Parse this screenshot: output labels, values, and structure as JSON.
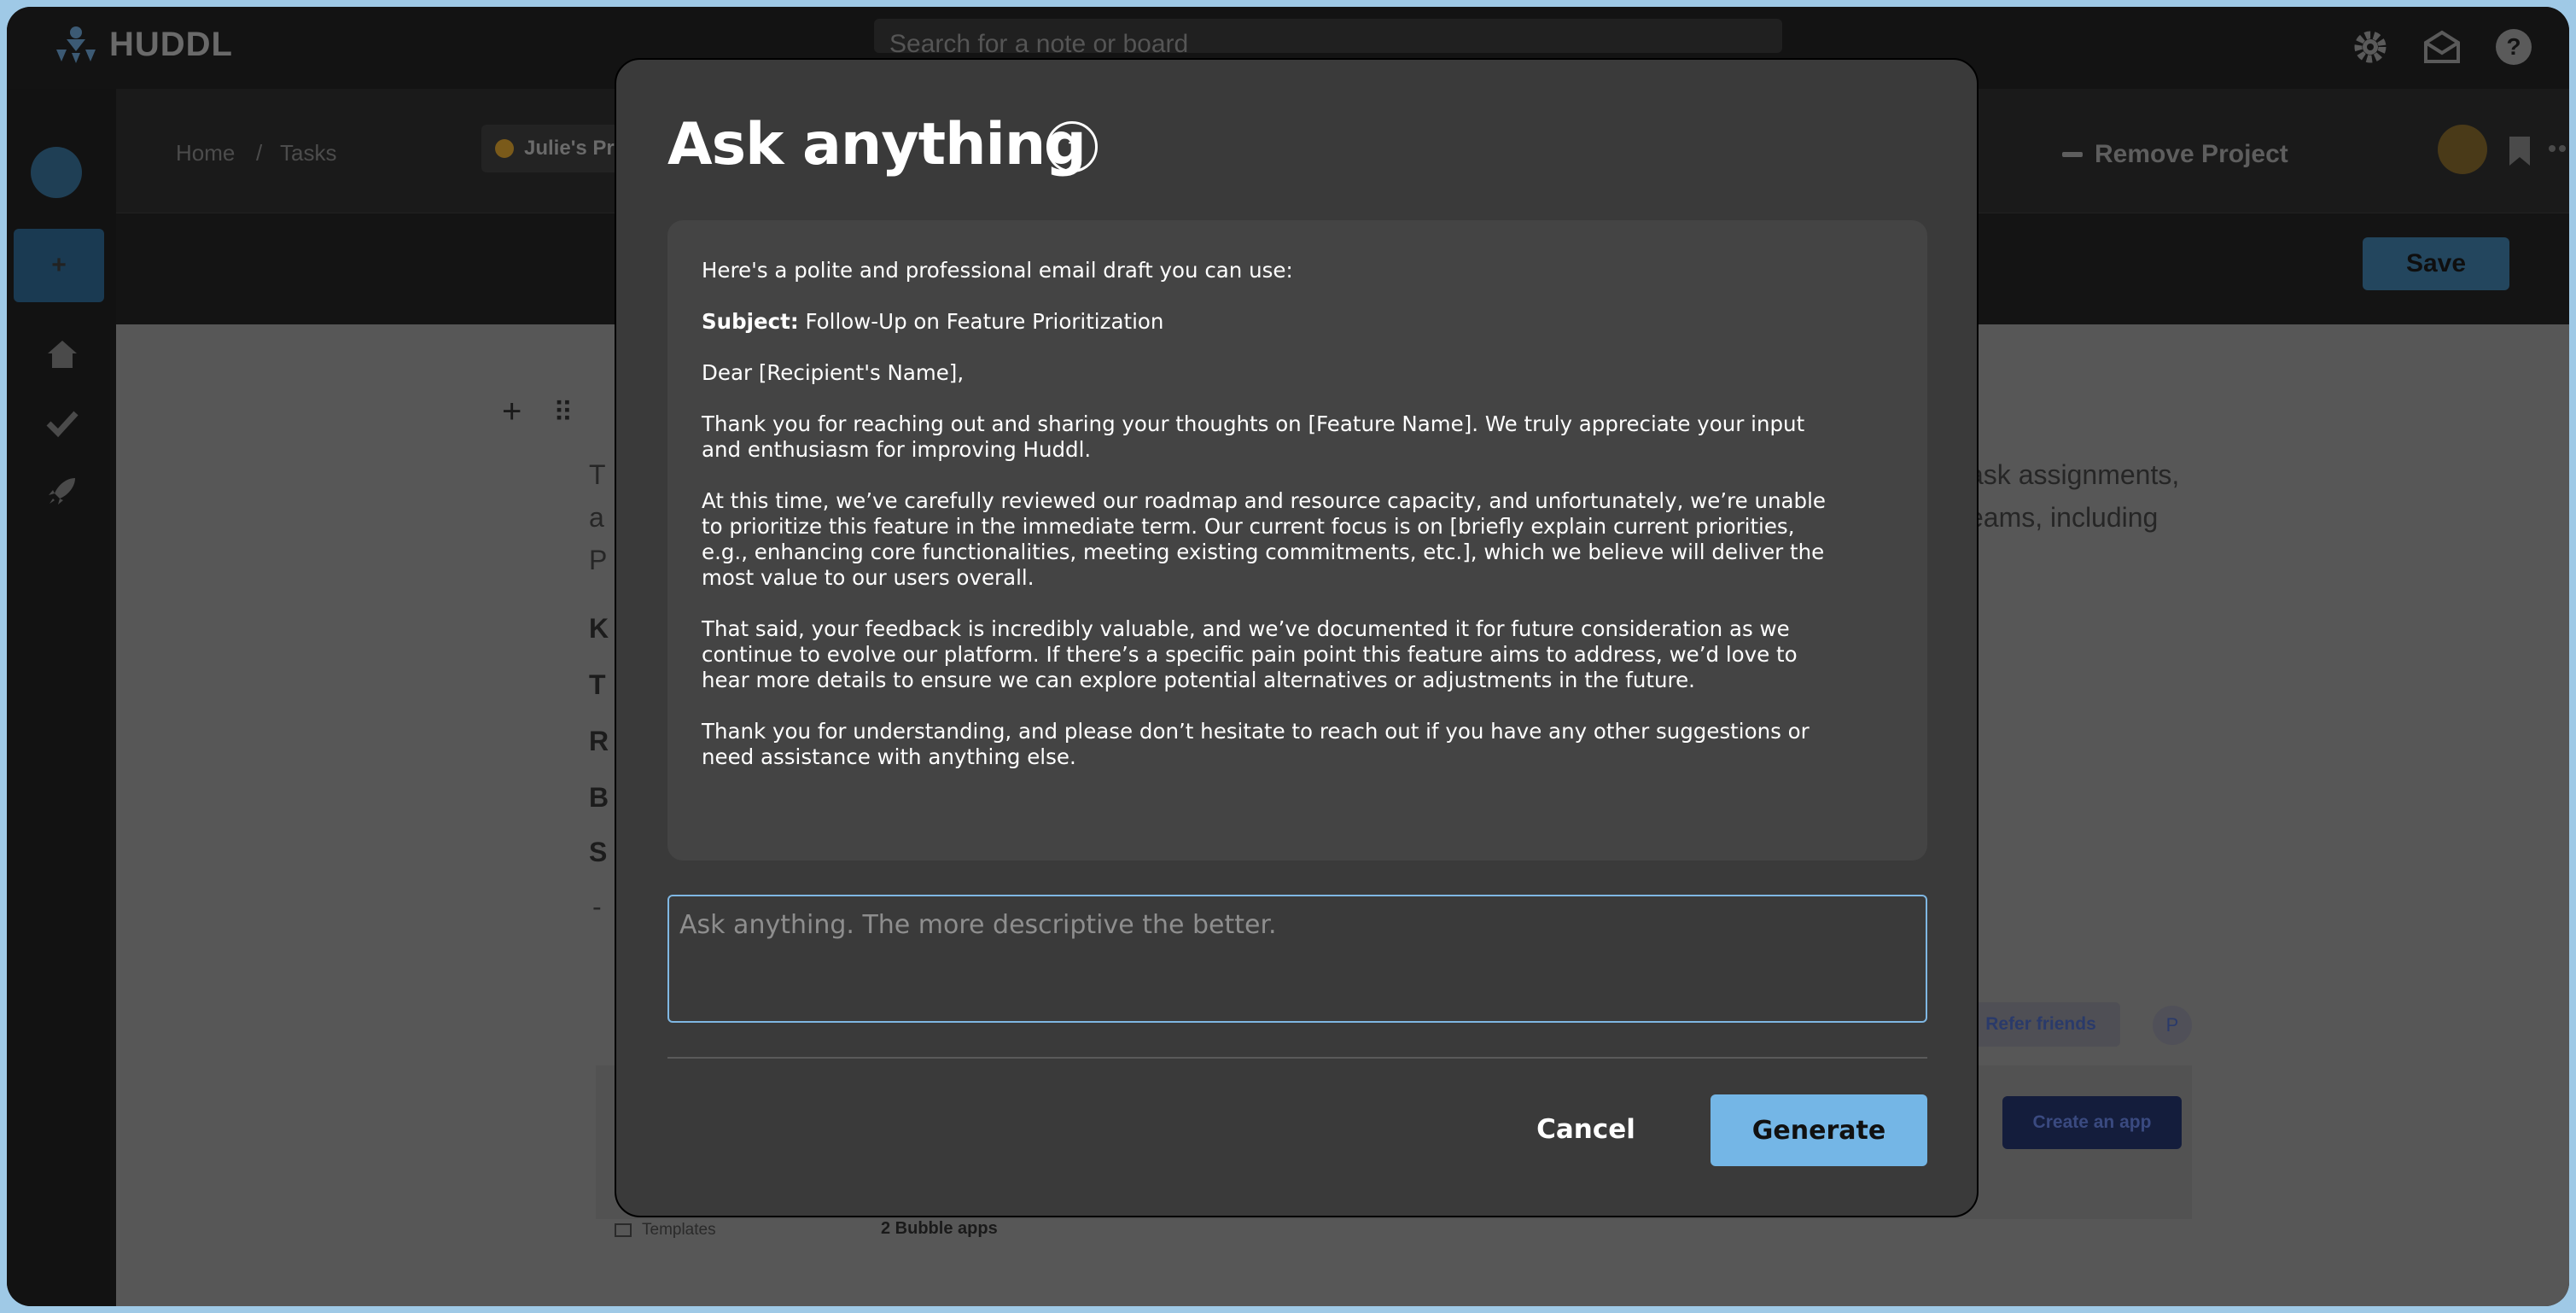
{
  "app": {
    "logo_text": "HUDDL"
  },
  "topbar": {
    "search_placeholder": "Search for a note or board"
  },
  "breadcrumb": {
    "home": "Home",
    "sep": "/",
    "tasks": "Tasks",
    "project": "Julie's Project"
  },
  "header": {
    "remove_project": "Remove Project",
    "save": "Save"
  },
  "background": {
    "line1_end": "ask assignments,",
    "line2_end": "eams, including",
    "letters": [
      "T",
      "a",
      "P",
      "K",
      "T",
      "R",
      "B",
      "S",
      "-"
    ],
    "refer_friends": "Refer friends",
    "profile_initial": "P",
    "create_app": "Create an app",
    "templates": "Templates",
    "bubble_apps": "2 Bubble apps"
  },
  "modal": {
    "title": "Ask anything",
    "info_glyph": "i",
    "response": {
      "intro": "Here's a polite and professional email draft you can use:",
      "subject_label": "Subject:",
      "subject_text": " Follow-Up on Feature Prioritization",
      "greeting": "Dear [Recipient's Name],",
      "p1": "Thank you for reaching out and sharing your thoughts on [Feature Name]. We truly appreciate your input and enthusiasm for improving Huddl.",
      "p2": "At this time, we’ve carefully reviewed our roadmap and resource capacity, and unfortunately, we’re unable to prioritize this feature in the immediate term. Our current focus is on [briefly explain current priorities, e.g., enhancing core functionalities, meeting existing commitments, etc.], which we believe will deliver the most value to our users overall.",
      "p3": "That said, your feedback is incredibly valuable, and we’ve documented it for future consideration as we continue to evolve our platform. If there’s a specific pain point this feature aims to address, we’d love to hear more details to ensure we can explore potential alternatives or adjustments in the future.",
      "p4": "Thank you for understanding, and please don’t hesitate to reach out if you have any other suggestions or need assistance with anything else."
    },
    "input_placeholder": "Ask anything. The more descriptive the better.",
    "cancel_label": "Cancel",
    "generate_label": "Generate"
  },
  "colors": {
    "accent": "#74b6e6",
    "modal_bg": "#3a3a3a",
    "response_bg": "#444444",
    "frame_border": "#9fc9e6"
  }
}
